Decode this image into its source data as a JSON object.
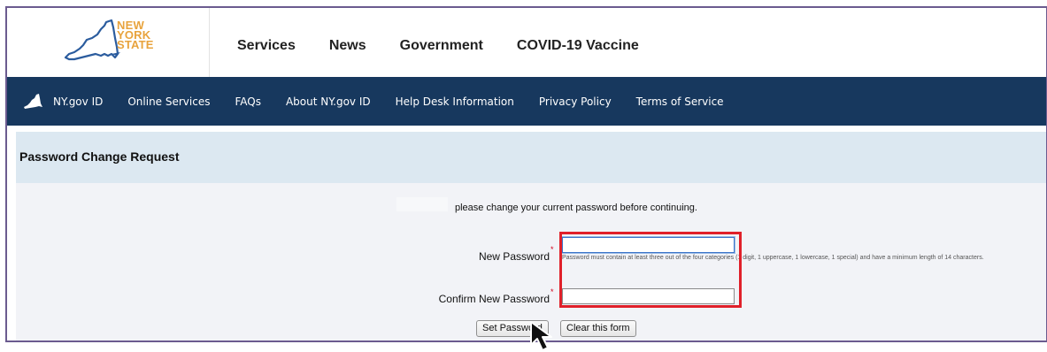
{
  "logo": {
    "line1": "NEW",
    "line2": "YORK",
    "line3": "STATE"
  },
  "top_nav": {
    "items": [
      "Services",
      "News",
      "Government",
      "COVID-19 Vaccine"
    ]
  },
  "blue_nav": {
    "items": [
      "NY.gov ID",
      "Online Services",
      "FAQs",
      "About NY.gov ID",
      "Help Desk Information",
      "Privacy Policy",
      "Terms of Service"
    ]
  },
  "page": {
    "title": "Password Change Request",
    "notice": "please change your current password before continuing."
  },
  "form": {
    "new_password_label": "New Password",
    "new_password_value": "",
    "confirm_password_label": "Confirm New Password",
    "confirm_password_value": "",
    "required_marker": "*",
    "hint": "Password must contain at least three out of the four categories (1 digit, 1 uppercase, 1 lowercase, 1 special) and have a minimum length of 14 characters."
  },
  "buttons": {
    "set_password": "Set Password",
    "clear_form": "Clear this form"
  },
  "colors": {
    "nav_bg": "#17385e",
    "title_band_bg": "#dce8f1",
    "form_bg": "#f2f3f7",
    "highlight_border": "#e0202a",
    "logo_gold": "#e8a33d",
    "logo_blue": "#2b5c9e"
  }
}
